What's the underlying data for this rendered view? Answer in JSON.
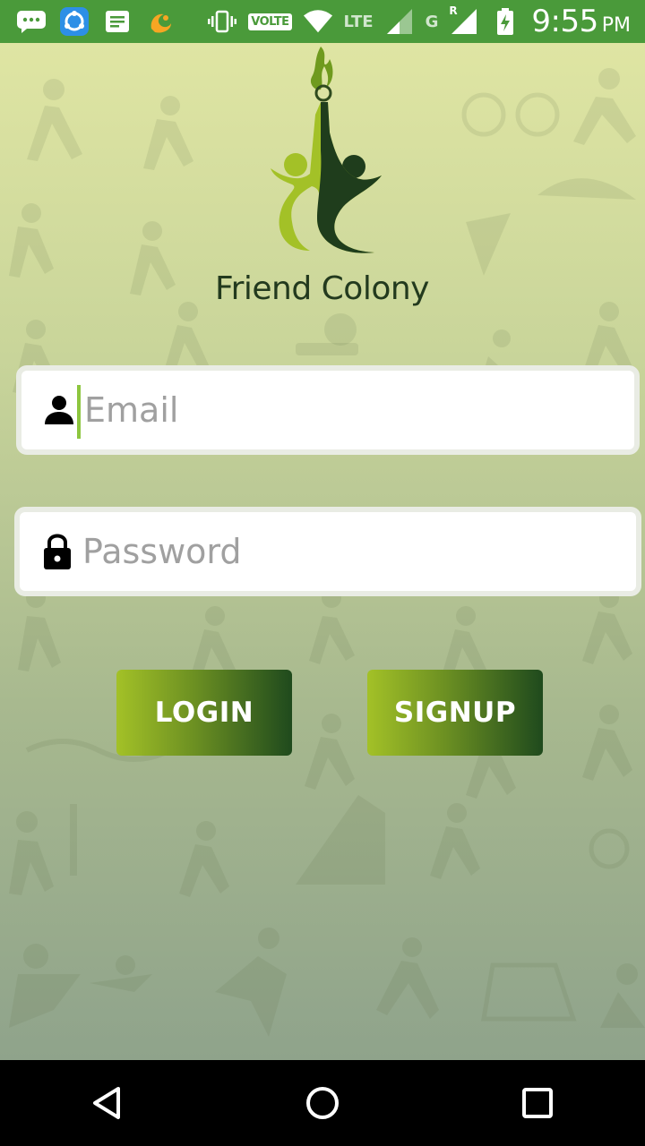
{
  "status_bar": {
    "volte_label": "VOLTE",
    "network_lte": "LTE",
    "network_g": "G",
    "roaming": "R",
    "time": "9:55",
    "ampm": "PM",
    "icons": [
      "message-icon",
      "shareit-icon",
      "notes-icon",
      "uc-browser-icon",
      "vibrate-icon",
      "wifi-icon",
      "signal-icon",
      "signal-roaming-icon",
      "battery-charging-icon"
    ]
  },
  "app": {
    "logo_text": "Friend Colony",
    "colors": {
      "accent_green": "#a3c127",
      "dark_green": "#1f4a1d",
      "status_bar": "#4a9a3a"
    }
  },
  "form": {
    "email_placeholder": "Email",
    "email_value": "",
    "password_placeholder": "Password",
    "password_value": "",
    "login_label": "LOGIN",
    "signup_label": "SIGNUP"
  },
  "nav": {
    "icons": [
      "back-icon",
      "home-icon",
      "recents-icon"
    ]
  }
}
